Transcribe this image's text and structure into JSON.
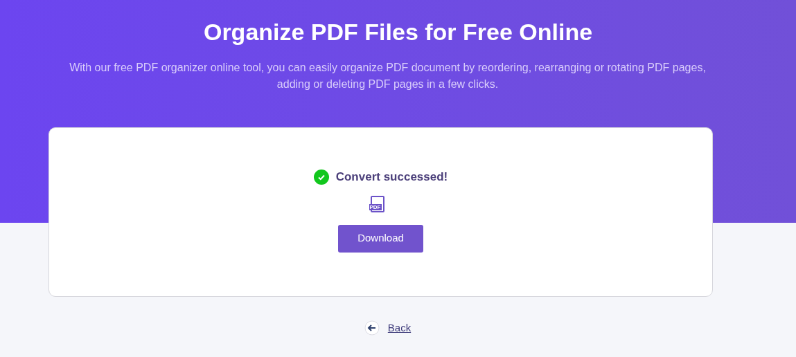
{
  "hero": {
    "title": "Organize PDF Files for Free Online",
    "subtitle": "With our free PDF organizer online tool, you can easily organize PDF document by reordering, rearranging or rotating PDF pages, adding or deleting PDF pages in a few clicks."
  },
  "result": {
    "message": "Convert successed!",
    "file_label": "PDF",
    "button": "Download"
  },
  "back": {
    "label": "Back"
  }
}
